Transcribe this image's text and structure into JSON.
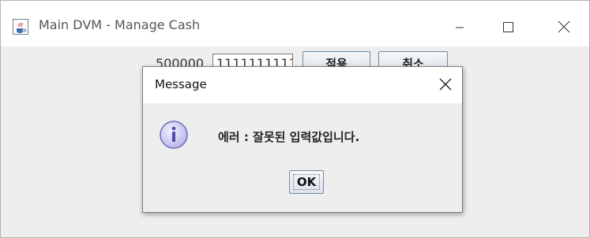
{
  "window": {
    "title": "Main DVM - Manage Cash",
    "app_icon": "java-cup-icon"
  },
  "controls": {
    "minimize_icon": "minimize-icon",
    "maximize_icon": "maximize-icon",
    "close_icon": "close-icon"
  },
  "background_form": {
    "label": "500000",
    "input_value": "1111111111",
    "apply_label": "적용",
    "cancel_label": "취소"
  },
  "dialog": {
    "title": "Message",
    "icon": "info-icon",
    "message": "에러 : 잘못된 입력값입니다.",
    "ok_label": "OK"
  },
  "colors": {
    "window_bg": "#ffffff",
    "content_bg": "#eeeeee",
    "dialog_bg": "#eeeeee",
    "info_icon_fill": "#c9c8f0",
    "info_icon_stroke": "#6b6bbf"
  }
}
